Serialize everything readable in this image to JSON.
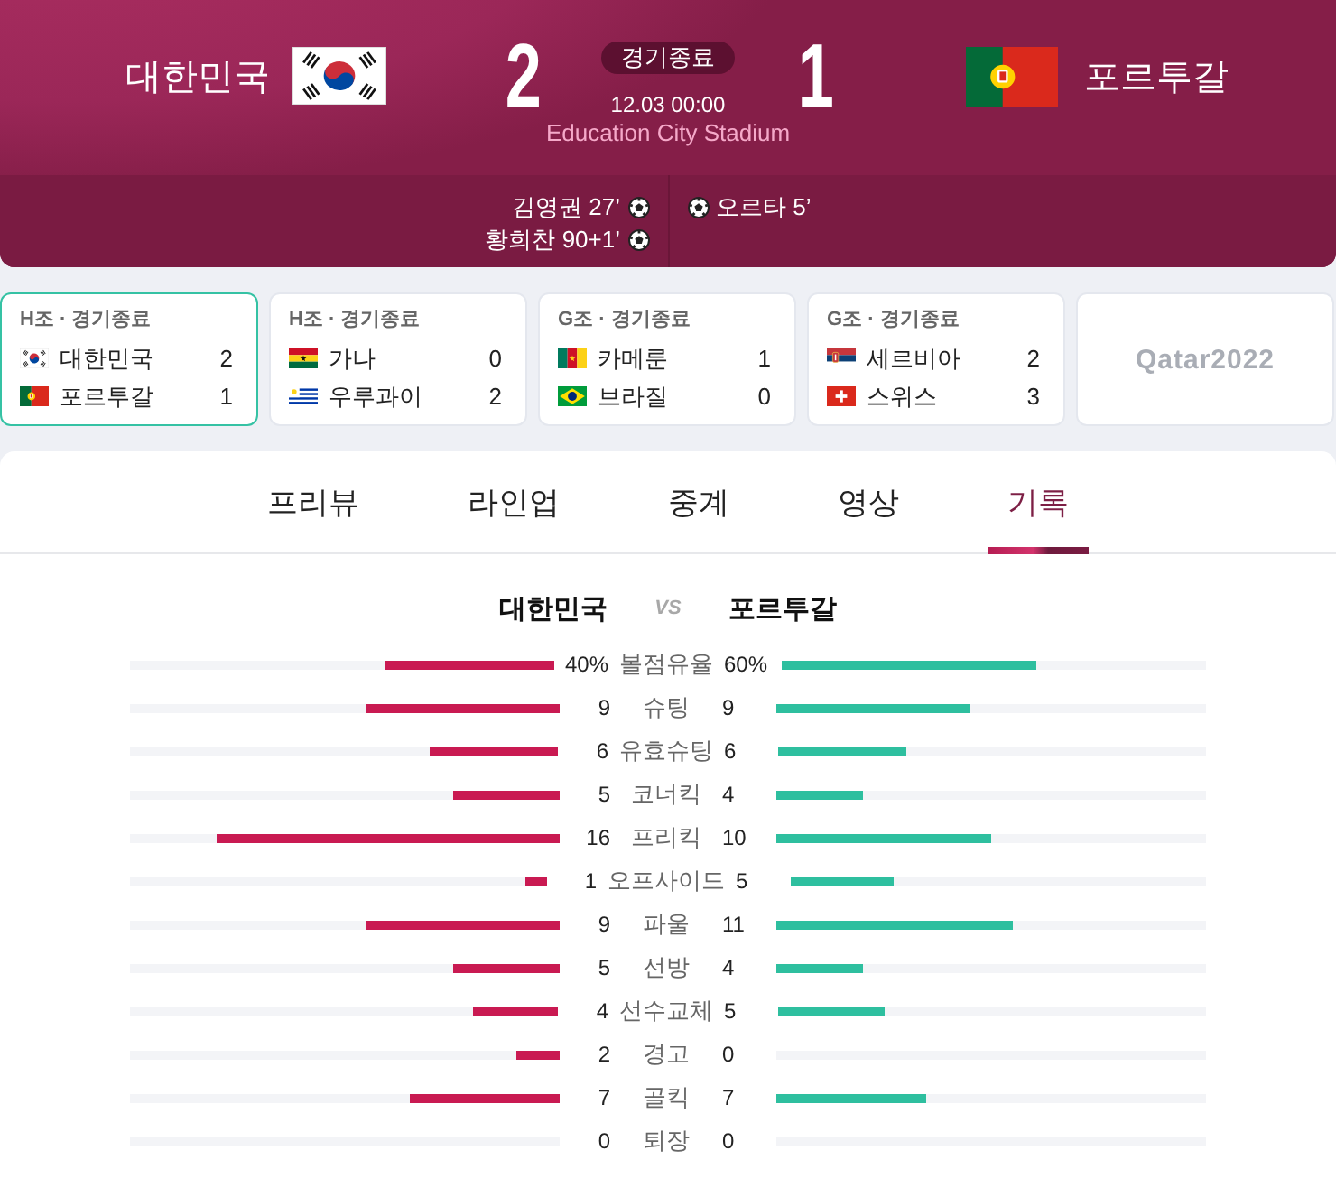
{
  "header": {
    "home": {
      "name": "대한민국",
      "kind": "korea",
      "score": "2"
    },
    "away": {
      "name": "포르투갈",
      "kind": "portugal",
      "score": "1"
    },
    "status": "경기종료",
    "datetime": "12.03 00:00",
    "venue": "Education City Stadium"
  },
  "goals": {
    "home": [
      "김영권 27’",
      "황희찬 90+1’"
    ],
    "away": [
      "오르타 5’"
    ]
  },
  "match_cards": [
    {
      "title": "H조 · 경기종료",
      "selected": true,
      "teams": [
        {
          "kind": "korea",
          "name": "대한민국",
          "score": "2"
        },
        {
          "kind": "portugal",
          "name": "포르투갈",
          "score": "1"
        }
      ]
    },
    {
      "title": "H조 · 경기종료",
      "selected": false,
      "teams": [
        {
          "kind": "ghana",
          "name": "가나",
          "score": "0"
        },
        {
          "kind": "uruguay",
          "name": "우루과이",
          "score": "2"
        }
      ]
    },
    {
      "title": "G조 · 경기종료",
      "selected": false,
      "teams": [
        {
          "kind": "cameroon",
          "name": "카메룬",
          "score": "1"
        },
        {
          "kind": "brazil",
          "name": "브라질",
          "score": "0"
        }
      ]
    },
    {
      "title": "G조 · 경기종료",
      "selected": false,
      "teams": [
        {
          "kind": "serbia",
          "name": "세르비아",
          "score": "2"
        },
        {
          "kind": "switzerland",
          "name": "스위스",
          "score": "3"
        }
      ]
    }
  ],
  "logo_card": {
    "text": "Qatar2022"
  },
  "tabs": [
    {
      "label": "프리뷰",
      "selected": false
    },
    {
      "label": "라인업",
      "selected": false
    },
    {
      "label": "중계",
      "selected": false
    },
    {
      "label": "영상",
      "selected": false
    },
    {
      "label": "기록",
      "selected": true
    }
  ],
  "stats": {
    "home": "대한민국",
    "vs": "VS",
    "away": "포르투갈",
    "rows": [
      {
        "label": "볼점유율",
        "home": {
          "value": "40%",
          "level": 0.4
        },
        "away": {
          "value": "60%",
          "level": 0.6
        }
      },
      {
        "label": "슈팅",
        "home": {
          "value": "9",
          "level": 0.45
        },
        "away": {
          "value": "9",
          "level": 0.45
        }
      },
      {
        "label": "유효슈팅",
        "home": {
          "value": "6",
          "level": 0.3
        },
        "away": {
          "value": "6",
          "level": 0.3
        }
      },
      {
        "label": "코너킥",
        "home": {
          "value": "5",
          "level": 0.25
        },
        "away": {
          "value": "4",
          "level": 0.2
        }
      },
      {
        "label": "프리킥",
        "home": {
          "value": "16",
          "level": 0.8
        },
        "away": {
          "value": "10",
          "level": 0.5
        }
      },
      {
        "label": "오프사이드",
        "home": {
          "value": "1",
          "level": 0.05
        },
        "away": {
          "value": "5",
          "level": 0.25
        }
      },
      {
        "label": "파울",
        "home": {
          "value": "9",
          "level": 0.45
        },
        "away": {
          "value": "11",
          "level": 0.55
        }
      },
      {
        "label": "선방",
        "home": {
          "value": "5",
          "level": 0.25
        },
        "away": {
          "value": "4",
          "level": 0.2
        }
      },
      {
        "label": "선수교체",
        "home": {
          "value": "4",
          "level": 0.2
        },
        "away": {
          "value": "5",
          "level": 0.25
        }
      },
      {
        "label": "경고",
        "home": {
          "value": "2",
          "level": 0.1
        },
        "away": {
          "value": "0"
        }
      },
      {
        "label": "골킥",
        "home": {
          "value": "7",
          "level": 0.35
        },
        "away": {
          "value": "7",
          "level": 0.35
        }
      },
      {
        "label": "퇴장",
        "home": {
          "value": "0"
        },
        "away": {
          "value": "0"
        }
      }
    ]
  }
}
